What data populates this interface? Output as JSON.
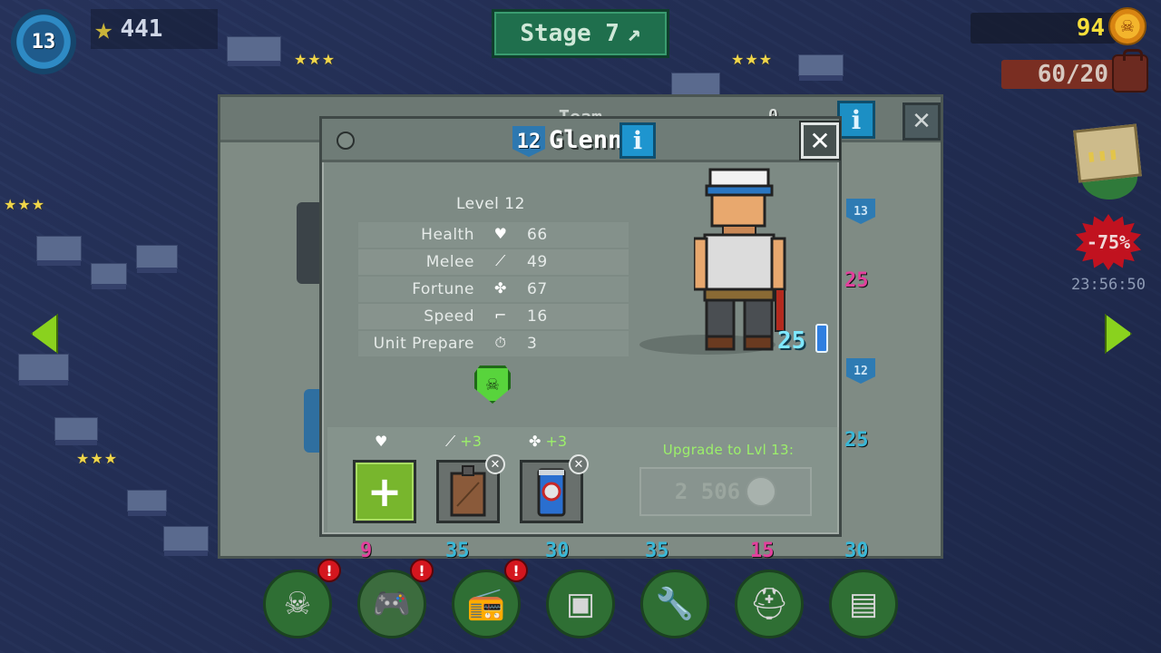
{
  "hud": {
    "player_level": "13",
    "stars_total": "441",
    "stage_button": "Stage 7",
    "coins": "94",
    "inventory": "60/20",
    "sale_badge": "-75%",
    "sale_timer": "23:56:50"
  },
  "map_stars": [
    "★★★",
    "★★★",
    "★★★",
    "★★★"
  ],
  "team_panel": {
    "title": "Team",
    "count": "0",
    "level_tags": [
      "13",
      "12"
    ],
    "right_values": [
      "25",
      "25"
    ],
    "bottom_values": [
      "9",
      "35",
      "30",
      "35",
      "15",
      "30"
    ]
  },
  "hero": {
    "level_badge": "12",
    "name": "Glenn",
    "level_text": "Level 12",
    "stats": [
      {
        "label": "Health",
        "icon": "heart-icon",
        "value": "66"
      },
      {
        "label": "Melee",
        "icon": "sword-icon",
        "value": "49"
      },
      {
        "label": "Fortune",
        "icon": "clover-icon",
        "value": "67"
      },
      {
        "label": "Speed",
        "icon": "boot-icon",
        "value": "16"
      },
      {
        "label": "Unit Prepare",
        "icon": "stopwatch-icon",
        "value": "3"
      }
    ],
    "energy": "25",
    "equipment": {
      "slot1_bonus": "",
      "slot2_bonus": "+3",
      "slot3_bonus": "+3"
    },
    "upgrade": {
      "label": "Upgrade to Lvl 13:",
      "cost": "2 506"
    }
  },
  "colors": {
    "accent_green": "#9cf06a",
    "info_blue": "#1e95cf",
    "coin_yellow": "#f6de3a",
    "sale_red": "#c1121f"
  }
}
